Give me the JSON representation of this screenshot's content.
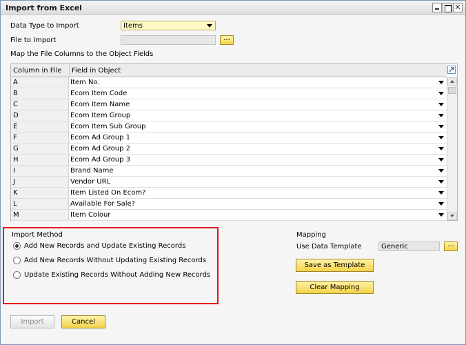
{
  "window": {
    "title": "Import from Excel"
  },
  "form": {
    "data_type_label": "Data Type to Import",
    "data_type_value": "Items",
    "file_label": "File to Import",
    "file_value": "",
    "browse_label": "...",
    "map_label": "Map the File Columns to the Object Fields"
  },
  "table": {
    "headers": [
      "Column in File",
      "Field in Object"
    ],
    "rows": [
      {
        "col": "A",
        "field": "Item No."
      },
      {
        "col": "B",
        "field": "Ecom Item Code"
      },
      {
        "col": "C",
        "field": "Ecom Item Name"
      },
      {
        "col": "D",
        "field": "Ecom Item Group"
      },
      {
        "col": "E",
        "field": "Ecom Item Sub Group"
      },
      {
        "col": "F",
        "field": "Ecom Ad Group 1"
      },
      {
        "col": "G",
        "field": "Ecom Ad Group 2"
      },
      {
        "col": "H",
        "field": "Ecom Ad Group 3"
      },
      {
        "col": "I",
        "field": "Brand Name"
      },
      {
        "col": "J",
        "field": "Vendor URL"
      },
      {
        "col": "K",
        "field": "Item Listed On Ecom?"
      },
      {
        "col": "L",
        "field": "Available For Sale?"
      },
      {
        "col": "M",
        "field": "Item Colour"
      }
    ]
  },
  "import_method": {
    "title": "Import Method",
    "selected": 0,
    "options": [
      "Add New Records and Update Existing Records",
      "Add New Records Without Updating Existing Records",
      "Update Existing Records Without Adding New Records"
    ]
  },
  "mapping": {
    "title": "Mapping",
    "template_label": "Use Data Template",
    "template_value": "Generic",
    "browse_label": "...",
    "save_template": "Save as Template",
    "clear_mapping": "Clear Mapping"
  },
  "footer": {
    "import": "Import",
    "cancel": "Cancel"
  },
  "colors": {
    "accent_yellow": "#f4d24a",
    "highlight_red": "#e01818",
    "combo_bg": "#fff9c4"
  }
}
